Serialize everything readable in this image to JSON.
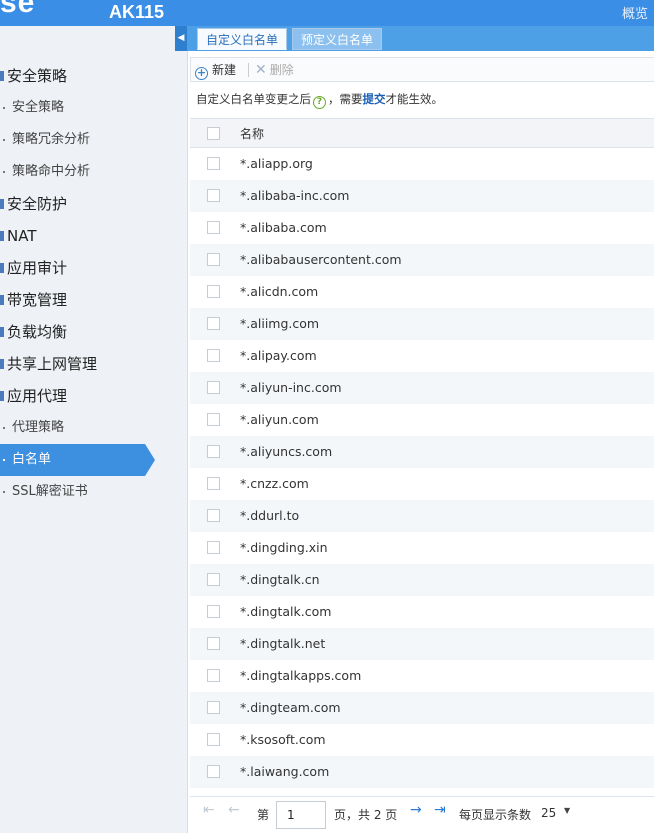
{
  "header": {
    "logo_text": "se",
    "model": "AK115",
    "overview_link": "概览"
  },
  "tabs": [
    {
      "label": "自定义白名单",
      "active": true
    },
    {
      "label": "预定义白名单",
      "active": false
    }
  ],
  "sidebar": {
    "items": [
      {
        "type": "group",
        "label": "安全策略"
      },
      {
        "type": "sub",
        "label": "安全策略"
      },
      {
        "type": "sub",
        "label": "策略冗余分析"
      },
      {
        "type": "sub",
        "label": "策略命中分析"
      },
      {
        "type": "group",
        "label": "安全防护"
      },
      {
        "type": "group",
        "label": "NAT"
      },
      {
        "type": "group",
        "label": "应用审计"
      },
      {
        "type": "group",
        "label": "带宽管理"
      },
      {
        "type": "group",
        "label": "负载均衡"
      },
      {
        "type": "group",
        "label": "共享上网管理"
      },
      {
        "type": "group",
        "label": "应用代理"
      },
      {
        "type": "sub",
        "label": "代理策略"
      },
      {
        "type": "sub",
        "label": "白名单",
        "active": true
      },
      {
        "type": "sub",
        "label": "SSL解密证书"
      }
    ]
  },
  "toolbar": {
    "new_label": "新建",
    "delete_label": "删除"
  },
  "hint": {
    "before": "自定义白名单变更之后",
    "middle": "，需要",
    "link": "提交",
    "after": "才能生效。"
  },
  "table": {
    "column_name": "名称",
    "rows": [
      "*.aliapp.org",
      "*.alibaba-inc.com",
      "*.alibaba.com",
      "*.alibabausercontent.com",
      "*.alicdn.com",
      "*.aliimg.com",
      "*.alipay.com",
      "*.aliyun-inc.com",
      "*.aliyun.com",
      "*.aliyuncs.com",
      "*.cnzz.com",
      "*.ddurl.to",
      "*.dingding.xin",
      "*.dingtalk.cn",
      "*.dingtalk.com",
      "*.dingtalk.net",
      "*.dingtalkapps.com",
      "*.dingteam.com",
      "*.ksosoft.com",
      "*.laiwang.com"
    ]
  },
  "pagination": {
    "page_prefix": "第",
    "current_page": "1",
    "page_suffix": "页，共 2 页",
    "per_page_label": "每页显示条数",
    "per_page_value": "25"
  }
}
